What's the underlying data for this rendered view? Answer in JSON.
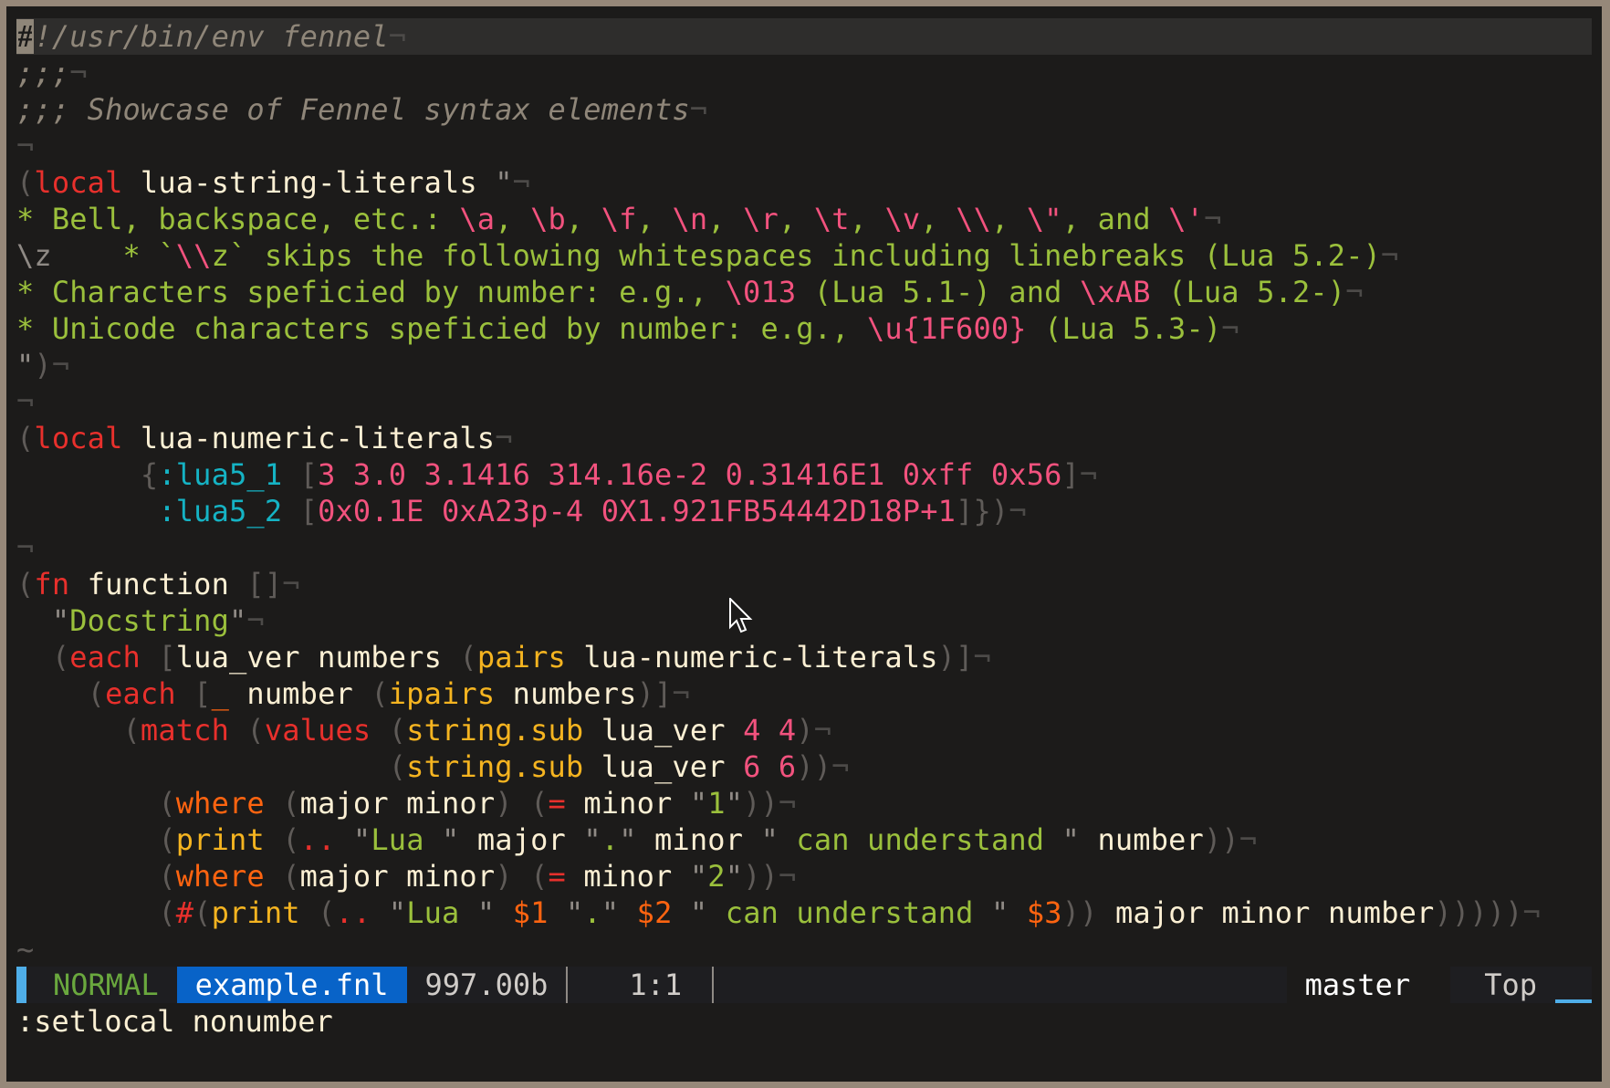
{
  "editor": {
    "mode": "NORMAL",
    "filename": "example.fnl",
    "filesize": "997.00b",
    "position": "1:1",
    "branch": "master",
    "scroll": "Top",
    "command_line": ":setlocal nonumber",
    "eol_marker": "¬",
    "empty_line_marker": "~",
    "colors": {
      "keyword": "#e8302c",
      "string": "#9bc03c",
      "number_escape": "#f2527e",
      "keyword_symbol": "#15b3c4",
      "builtin_function": "#f5b420",
      "pattern_keyword": "#ff6410",
      "comment": "#8f8679",
      "mode_accent": "#4faee8",
      "filename_bg": "#0863c8"
    }
  },
  "lines": [
    [
      {
        "t": "#",
        "c": "c-cm cursor-block"
      },
      {
        "t": "!/usr/bin/env fennel",
        "c": "c-cm"
      }
    ],
    [
      {
        "t": ";;;",
        "c": "c-cm"
      }
    ],
    [
      {
        "t": ";;; Showcase of Fennel syntax elements",
        "c": "c-cm"
      }
    ],
    [],
    [
      {
        "t": "(",
        "c": "c-p"
      },
      {
        "t": "local",
        "c": "c-kw"
      },
      {
        "t": " lua-string-literals ",
        "c": "c-id"
      },
      {
        "t": "\"",
        "c": "c-q"
      }
    ],
    [
      {
        "t": "* Bell, backspace, etc.: ",
        "c": "c-str"
      },
      {
        "t": "\\a",
        "c": "c-esc"
      },
      {
        "t": ", ",
        "c": "c-str"
      },
      {
        "t": "\\b",
        "c": "c-esc"
      },
      {
        "t": ", ",
        "c": "c-str"
      },
      {
        "t": "\\f",
        "c": "c-esc"
      },
      {
        "t": ", ",
        "c": "c-str"
      },
      {
        "t": "\\n",
        "c": "c-esc"
      },
      {
        "t": ", ",
        "c": "c-str"
      },
      {
        "t": "\\r",
        "c": "c-esc"
      },
      {
        "t": ", ",
        "c": "c-str"
      },
      {
        "t": "\\t",
        "c": "c-esc"
      },
      {
        "t": ", ",
        "c": "c-str"
      },
      {
        "t": "\\v",
        "c": "c-esc"
      },
      {
        "t": ", ",
        "c": "c-str"
      },
      {
        "t": "\\\\",
        "c": "c-esc"
      },
      {
        "t": ", ",
        "c": "c-str"
      },
      {
        "t": "\\\"",
        "c": "c-esc"
      },
      {
        "t": ", and ",
        "c": "c-str"
      },
      {
        "t": "\\'",
        "c": "c-esc"
      }
    ],
    [
      {
        "t": "\\z    ",
        "c": "c-gray"
      },
      {
        "t": "* `",
        "c": "c-str"
      },
      {
        "t": "\\\\",
        "c": "c-esc"
      },
      {
        "t": "z` skips the following whitespaces including linebreaks (Lua 5.2-)",
        "c": "c-str"
      }
    ],
    [
      {
        "t": "* Characters speficied by number: e.g., ",
        "c": "c-str"
      },
      {
        "t": "\\013",
        "c": "c-esc"
      },
      {
        "t": " (Lua 5.1-) and ",
        "c": "c-str"
      },
      {
        "t": "\\xAB",
        "c": "c-esc"
      },
      {
        "t": " (Lua 5.2-)",
        "c": "c-str"
      }
    ],
    [
      {
        "t": "* Unicode characters speficied by number: e.g., ",
        "c": "c-str"
      },
      {
        "t": "\\u{1F600}",
        "c": "c-esc"
      },
      {
        "t": " (Lua 5.3-)",
        "c": "c-str"
      }
    ],
    [
      {
        "t": "\"",
        "c": "c-q"
      },
      {
        "t": ")",
        "c": "c-p"
      }
    ],
    [],
    [
      {
        "t": "(",
        "c": "c-p"
      },
      {
        "t": "local",
        "c": "c-kw"
      },
      {
        "t": " lua-numeric-literals",
        "c": "c-id"
      }
    ],
    [
      {
        "t": "       {",
        "c": "c-p"
      },
      {
        "t": ":lua5_1",
        "c": "c-kwd"
      },
      {
        "t": " [",
        "c": "c-p"
      },
      {
        "t": "3 3.0 3.1416 314.16e-2 0.31416E1 0xff 0x56",
        "c": "c-num"
      },
      {
        "t": "]",
        "c": "c-p"
      }
    ],
    [
      {
        "t": "        ",
        "c": "c-p"
      },
      {
        "t": ":lua5_2",
        "c": "c-kwd"
      },
      {
        "t": " [",
        "c": "c-p"
      },
      {
        "t": "0x0.1E 0xA23p-4 0X1.921FB54442D18P+1",
        "c": "c-num"
      },
      {
        "t": "]})",
        "c": "c-p"
      }
    ],
    [],
    [
      {
        "t": "(",
        "c": "c-p"
      },
      {
        "t": "fn",
        "c": "c-kw"
      },
      {
        "t": " function ",
        "c": "c-id"
      },
      {
        "t": "[]",
        "c": "c-p"
      }
    ],
    [
      {
        "t": "  \"",
        "c": "c-q"
      },
      {
        "t": "Docstring",
        "c": "c-str"
      },
      {
        "t": "\"",
        "c": "c-q"
      }
    ],
    [
      {
        "t": "  (",
        "c": "c-p"
      },
      {
        "t": "each",
        "c": "c-kw"
      },
      {
        "t": " [",
        "c": "c-p"
      },
      {
        "t": "lua_ver numbers ",
        "c": "c-id"
      },
      {
        "t": "(",
        "c": "c-p"
      },
      {
        "t": "pairs",
        "c": "c-fn"
      },
      {
        "t": " lua-numeric-literals",
        "c": "c-id"
      },
      {
        "t": ")]",
        "c": "c-p"
      }
    ],
    [
      {
        "t": "    (",
        "c": "c-p"
      },
      {
        "t": "each",
        "c": "c-kw"
      },
      {
        "t": " [",
        "c": "c-p"
      },
      {
        "t": "_",
        "c": "c-wh"
      },
      {
        "t": " number ",
        "c": "c-id"
      },
      {
        "t": "(",
        "c": "c-p"
      },
      {
        "t": "ipairs",
        "c": "c-fn"
      },
      {
        "t": " numbers",
        "c": "c-id"
      },
      {
        "t": ")]",
        "c": "c-p"
      }
    ],
    [
      {
        "t": "      (",
        "c": "c-p"
      },
      {
        "t": "match",
        "c": "c-kw"
      },
      {
        "t": " (",
        "c": "c-p"
      },
      {
        "t": "values",
        "c": "c-kw"
      },
      {
        "t": " (",
        "c": "c-p"
      },
      {
        "t": "string.sub",
        "c": "c-fn"
      },
      {
        "t": " lua_ver ",
        "c": "c-id"
      },
      {
        "t": "4 4",
        "c": "c-num"
      },
      {
        "t": ")",
        "c": "c-p"
      }
    ],
    [
      {
        "t": "                     (",
        "c": "c-p"
      },
      {
        "t": "string.sub",
        "c": "c-fn"
      },
      {
        "t": " lua_ver ",
        "c": "c-id"
      },
      {
        "t": "6 6",
        "c": "c-num"
      },
      {
        "t": "))",
        "c": "c-p"
      }
    ],
    [
      {
        "t": "        (",
        "c": "c-p"
      },
      {
        "t": "where",
        "c": "c-wh"
      },
      {
        "t": " (",
        "c": "c-p"
      },
      {
        "t": "major minor",
        "c": "c-id"
      },
      {
        "t": ") (",
        "c": "c-p"
      },
      {
        "t": "=",
        "c": "c-kw"
      },
      {
        "t": " minor ",
        "c": "c-id"
      },
      {
        "t": "\"",
        "c": "c-q"
      },
      {
        "t": "1",
        "c": "c-str"
      },
      {
        "t": "\"",
        "c": "c-q"
      },
      {
        "t": "))",
        "c": "c-p"
      }
    ],
    [
      {
        "t": "        (",
        "c": "c-p"
      },
      {
        "t": "print",
        "c": "c-fn"
      },
      {
        "t": " (",
        "c": "c-p"
      },
      {
        "t": "..",
        "c": "c-kw"
      },
      {
        "t": " \"",
        "c": "c-q"
      },
      {
        "t": "Lua ",
        "c": "c-str"
      },
      {
        "t": "\"",
        "c": "c-q"
      },
      {
        "t": " major ",
        "c": "c-id"
      },
      {
        "t": "\"",
        "c": "c-q"
      },
      {
        "t": ".",
        "c": "c-str"
      },
      {
        "t": "\"",
        "c": "c-q"
      },
      {
        "t": " minor ",
        "c": "c-id"
      },
      {
        "t": "\"",
        "c": "c-q"
      },
      {
        "t": " can understand ",
        "c": "c-str"
      },
      {
        "t": "\"",
        "c": "c-q"
      },
      {
        "t": " number",
        "c": "c-id"
      },
      {
        "t": "))",
        "c": "c-p"
      }
    ],
    [
      {
        "t": "        (",
        "c": "c-p"
      },
      {
        "t": "where",
        "c": "c-wh"
      },
      {
        "t": " (",
        "c": "c-p"
      },
      {
        "t": "major minor",
        "c": "c-id"
      },
      {
        "t": ") (",
        "c": "c-p"
      },
      {
        "t": "=",
        "c": "c-kw"
      },
      {
        "t": " minor ",
        "c": "c-id"
      },
      {
        "t": "\"",
        "c": "c-q"
      },
      {
        "t": "2",
        "c": "c-str"
      },
      {
        "t": "\"",
        "c": "c-q"
      },
      {
        "t": "))",
        "c": "c-p"
      }
    ],
    [
      {
        "t": "        (",
        "c": "c-p"
      },
      {
        "t": "#",
        "c": "c-kw"
      },
      {
        "t": "(",
        "c": "c-p"
      },
      {
        "t": "print",
        "c": "c-fn"
      },
      {
        "t": " (",
        "c": "c-p"
      },
      {
        "t": "..",
        "c": "c-kw"
      },
      {
        "t": " \"",
        "c": "c-q"
      },
      {
        "t": "Lua ",
        "c": "c-str"
      },
      {
        "t": "\"",
        "c": "c-q"
      },
      {
        "t": " ",
        "c": "c-id"
      },
      {
        "t": "$1",
        "c": "c-wh"
      },
      {
        "t": " \"",
        "c": "c-q"
      },
      {
        "t": ".",
        "c": "c-str"
      },
      {
        "t": "\"",
        "c": "c-q"
      },
      {
        "t": " ",
        "c": "c-id"
      },
      {
        "t": "$2",
        "c": "c-wh"
      },
      {
        "t": " \"",
        "c": "c-q"
      },
      {
        "t": " can understand ",
        "c": "c-str"
      },
      {
        "t": "\"",
        "c": "c-q"
      },
      {
        "t": " ",
        "c": "c-id"
      },
      {
        "t": "$3",
        "c": "c-wh"
      },
      {
        "t": "))",
        "c": "c-p"
      },
      {
        "t": " major minor number",
        "c": "c-id"
      },
      {
        "t": ")))))",
        "c": "c-p"
      }
    ]
  ]
}
